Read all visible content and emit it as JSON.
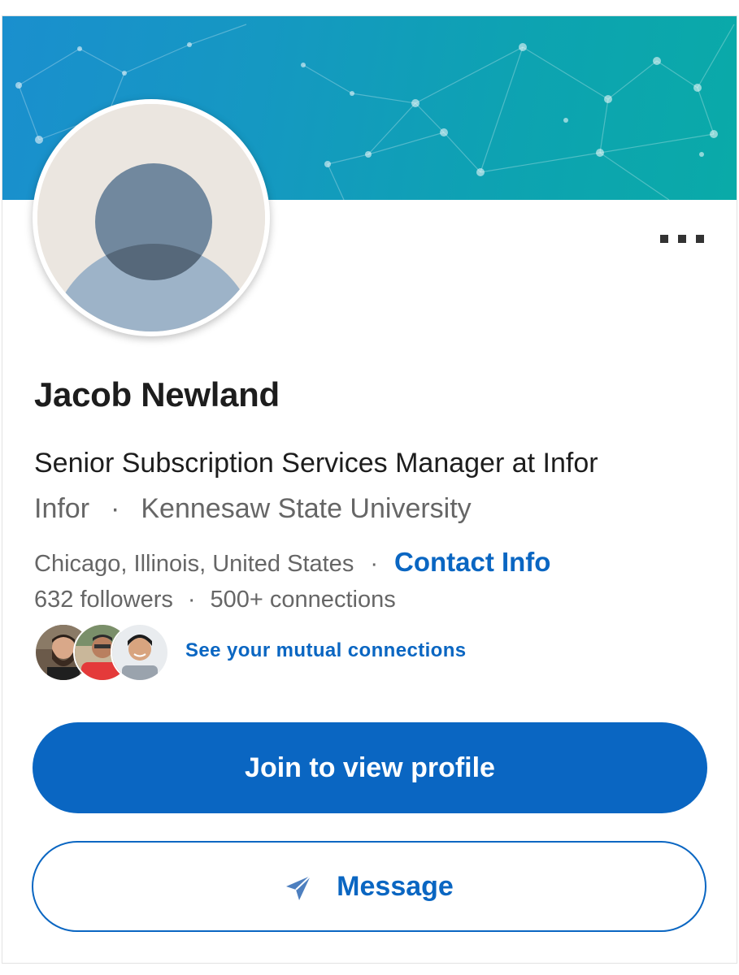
{
  "profile": {
    "name": "Jacob Newland",
    "headline": "Senior Subscription Services Manager at Infor",
    "company": "Infor",
    "school": "Kennesaw State University",
    "location": "Chicago, Illinois, United States",
    "contact_label": "Contact Info",
    "followers": "632 followers",
    "connections": "500+ connections",
    "separator": "·"
  },
  "mutual": {
    "link_label": "See your mutual connections",
    "avatars": [
      "mutual-avatar-1",
      "mutual-avatar-2",
      "mutual-avatar-3"
    ]
  },
  "actions": {
    "join_label": "Join to view profile",
    "message_label": "Message"
  },
  "icons": {
    "more": "more-horizontal-icon",
    "send": "send-icon"
  },
  "colors": {
    "accent": "#0a66c2",
    "banner_start": "#1a8fce",
    "banner_end": "#0aaaa8",
    "text_primary": "#1d1d1d",
    "text_secondary": "#666666"
  }
}
